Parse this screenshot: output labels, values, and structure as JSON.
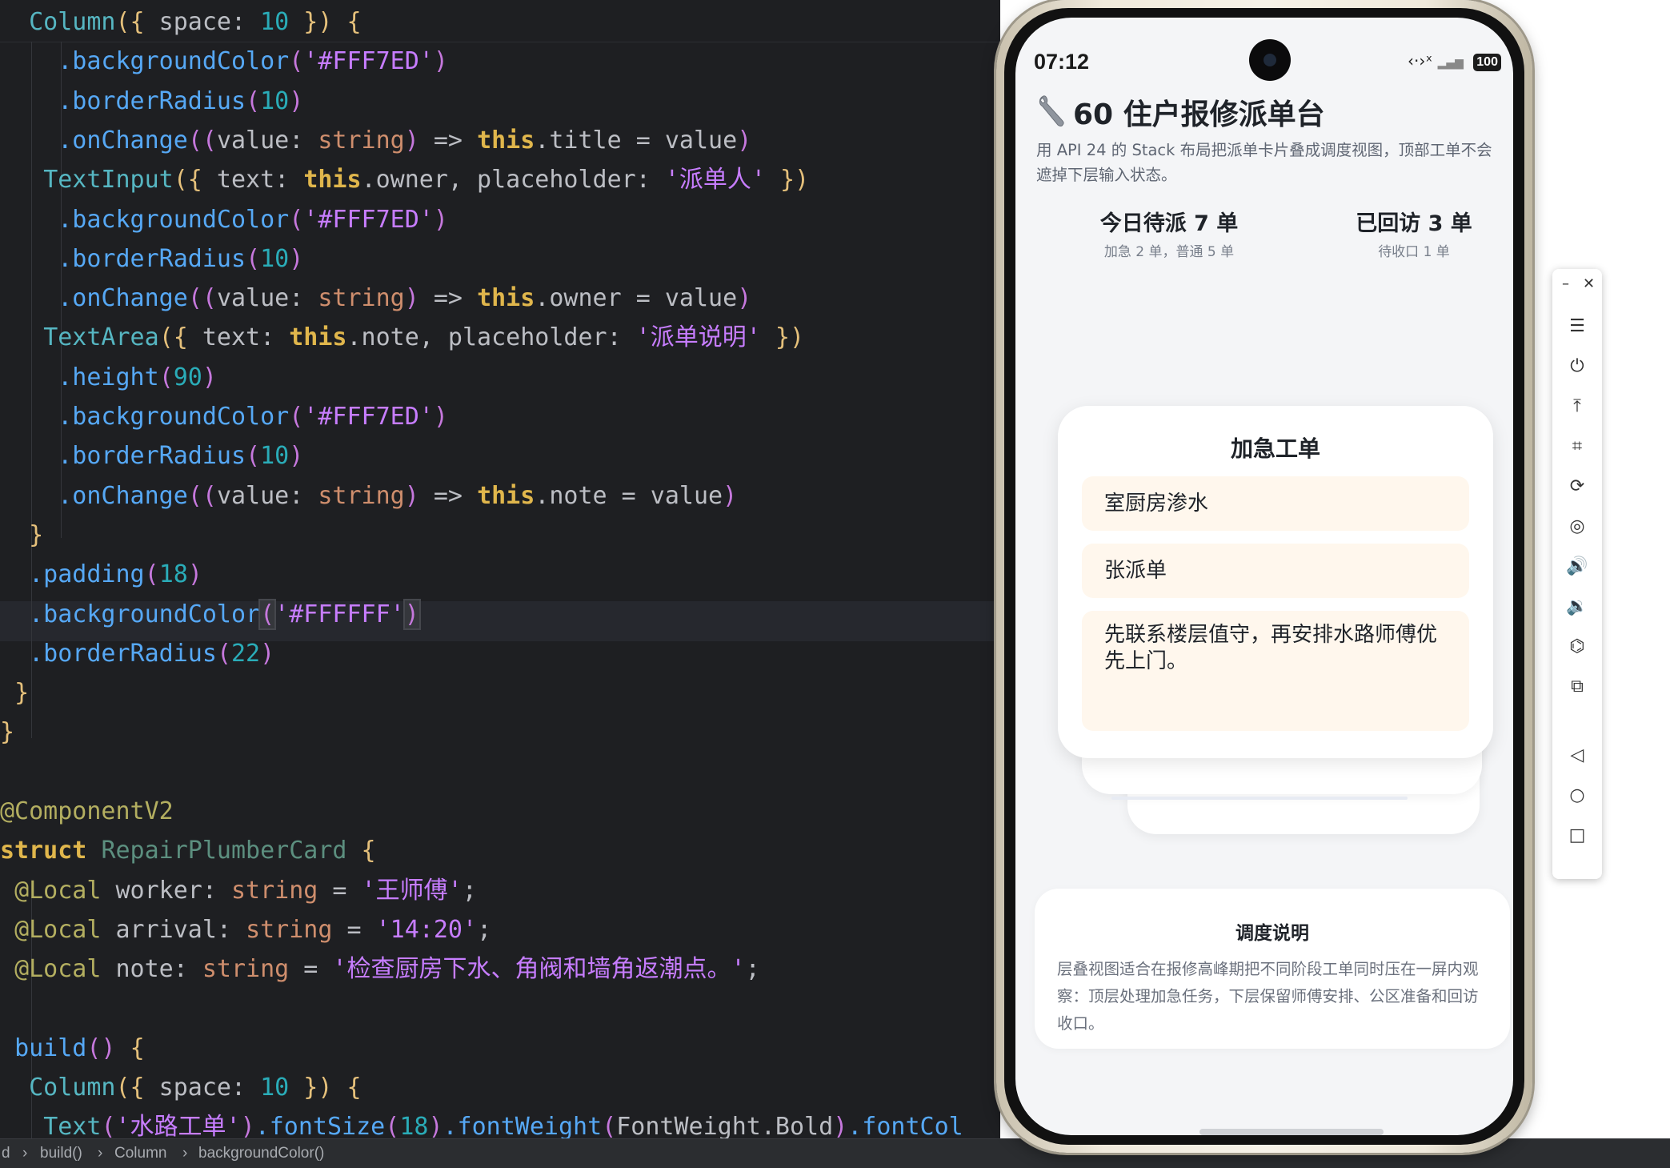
{
  "editor": {
    "lines": [
      [
        [
          "k-pl",
          "  "
        ],
        [
          "k-cm",
          "Column"
        ],
        [
          "k-br",
          "({"
        ],
        [
          "k-pl",
          " space: "
        ],
        [
          "k-num",
          "10"
        ],
        [
          "k-br",
          " })"
        ],
        [
          "k-pl",
          " "
        ],
        [
          "k-br",
          "{"
        ]
      ],
      [
        [
          "k-pl",
          "    "
        ],
        [
          "k-fn",
          ".backgroundColor"
        ],
        [
          "k-bp",
          "("
        ],
        [
          "k-st",
          "'#FFF7ED'"
        ],
        [
          "k-bp",
          ")"
        ]
      ],
      [
        [
          "k-pl",
          "    "
        ],
        [
          "k-fn",
          ".borderRadius"
        ],
        [
          "k-bp",
          "("
        ],
        [
          "k-num",
          "10"
        ],
        [
          "k-bp",
          ")"
        ]
      ],
      [
        [
          "k-pl",
          "    "
        ],
        [
          "k-fn",
          ".onChange"
        ],
        [
          "k-bp",
          "(("
        ],
        [
          "k-pl",
          "value: "
        ],
        [
          "k-ty",
          "string"
        ],
        [
          "k-bp",
          ")"
        ],
        [
          "k-pl",
          " => "
        ],
        [
          "k-kw",
          "this"
        ],
        [
          "k-pl",
          ".title = value"
        ],
        [
          "k-bp",
          ")"
        ]
      ],
      [
        [
          "k-pl",
          "   "
        ],
        [
          "k-cm",
          "TextInput"
        ],
        [
          "k-br",
          "({"
        ],
        [
          "k-pl",
          " text: "
        ],
        [
          "k-kw",
          "this"
        ],
        [
          "k-pl",
          ".owner, placeholder: "
        ],
        [
          "k-st",
          "'派单人'"
        ],
        [
          "k-br",
          " })"
        ]
      ],
      [
        [
          "k-pl",
          "    "
        ],
        [
          "k-fn",
          ".backgroundColor"
        ],
        [
          "k-bp",
          "("
        ],
        [
          "k-st",
          "'#FFF7ED'"
        ],
        [
          "k-bp",
          ")"
        ]
      ],
      [
        [
          "k-pl",
          "    "
        ],
        [
          "k-fn",
          ".borderRadius"
        ],
        [
          "k-bp",
          "("
        ],
        [
          "k-num",
          "10"
        ],
        [
          "k-bp",
          ")"
        ]
      ],
      [
        [
          "k-pl",
          "    "
        ],
        [
          "k-fn",
          ".onChange"
        ],
        [
          "k-bp",
          "(("
        ],
        [
          "k-pl",
          "value: "
        ],
        [
          "k-ty",
          "string"
        ],
        [
          "k-bp",
          ")"
        ],
        [
          "k-pl",
          " => "
        ],
        [
          "k-kw",
          "this"
        ],
        [
          "k-pl",
          ".owner = value"
        ],
        [
          "k-bp",
          ")"
        ]
      ],
      [
        [
          "k-pl",
          "   "
        ],
        [
          "k-cm",
          "TextArea"
        ],
        [
          "k-br",
          "({"
        ],
        [
          "k-pl",
          " text: "
        ],
        [
          "k-kw",
          "this"
        ],
        [
          "k-pl",
          ".note, placeholder: "
        ],
        [
          "k-st",
          "'派单说明'"
        ],
        [
          "k-br",
          " })"
        ]
      ],
      [
        [
          "k-pl",
          "    "
        ],
        [
          "k-fn",
          ".height"
        ],
        [
          "k-bp",
          "("
        ],
        [
          "k-num",
          "90"
        ],
        [
          "k-bp",
          ")"
        ]
      ],
      [
        [
          "k-pl",
          "    "
        ],
        [
          "k-fn",
          ".backgroundColor"
        ],
        [
          "k-bp",
          "("
        ],
        [
          "k-st",
          "'#FFF7ED'"
        ],
        [
          "k-bp",
          ")"
        ]
      ],
      [
        [
          "k-pl",
          "    "
        ],
        [
          "k-fn",
          ".borderRadius"
        ],
        [
          "k-bp",
          "("
        ],
        [
          "k-num",
          "10"
        ],
        [
          "k-bp",
          ")"
        ]
      ],
      [
        [
          "k-pl",
          "    "
        ],
        [
          "k-fn",
          ".onChange"
        ],
        [
          "k-bp",
          "(("
        ],
        [
          "k-pl",
          "value: "
        ],
        [
          "k-ty",
          "string"
        ],
        [
          "k-bp",
          ")"
        ],
        [
          "k-pl",
          " => "
        ],
        [
          "k-kw",
          "this"
        ],
        [
          "k-pl",
          ".note = value"
        ],
        [
          "k-bp",
          ")"
        ]
      ],
      [
        [
          "k-pl",
          "  "
        ],
        [
          "k-br",
          "}"
        ]
      ],
      [
        [
          "k-pl",
          "  "
        ],
        [
          "k-fn",
          ".padding"
        ],
        [
          "k-bp",
          "("
        ],
        [
          "k-num",
          "18"
        ],
        [
          "k-bp",
          ")"
        ]
      ],
      [
        [
          "k-pl",
          "  "
        ],
        [
          "k-fn",
          ".backgroundColor"
        ],
        [
          "k-bp caret-box",
          "("
        ],
        [
          "k-st",
          "'#FFFFFF'"
        ],
        [
          "k-bp caret-box",
          ")"
        ]
      ],
      [
        [
          "k-pl",
          "  "
        ],
        [
          "k-fn",
          ".borderRadius"
        ],
        [
          "k-bp",
          "("
        ],
        [
          "k-num",
          "22"
        ],
        [
          "k-bp",
          ")"
        ]
      ],
      [
        [
          "k-pl",
          " "
        ],
        [
          "k-br",
          "}"
        ]
      ],
      [
        [
          "k-br",
          "}"
        ]
      ],
      [
        [
          "k-pl",
          ""
        ]
      ],
      [
        [
          "k-an",
          "@ComponentV2"
        ]
      ],
      [
        [
          "k-kw",
          "struct"
        ],
        [
          "k-pl",
          " "
        ],
        [
          "k-sn",
          "RepairPlumberCard"
        ],
        [
          "k-pl",
          " "
        ],
        [
          "k-br",
          "{"
        ]
      ],
      [
        [
          "k-pl",
          " "
        ],
        [
          "k-an",
          "@Local"
        ],
        [
          "k-pl",
          " worker: "
        ],
        [
          "k-ty",
          "string"
        ],
        [
          "k-pl",
          " = "
        ],
        [
          "k-st",
          "'王师傅'"
        ],
        [
          "k-pl",
          ";"
        ]
      ],
      [
        [
          "k-pl",
          " "
        ],
        [
          "k-an",
          "@Local"
        ],
        [
          "k-pl",
          " arrival: "
        ],
        [
          "k-ty",
          "string"
        ],
        [
          "k-pl",
          " = "
        ],
        [
          "k-st",
          "'14:20'"
        ],
        [
          "k-pl",
          ";"
        ]
      ],
      [
        [
          "k-pl",
          " "
        ],
        [
          "k-an",
          "@Local"
        ],
        [
          "k-pl",
          " note: "
        ],
        [
          "k-ty",
          "string"
        ],
        [
          "k-pl",
          " = "
        ],
        [
          "k-st",
          "'检查厨房下水、角阀和墙角返潮点。'"
        ],
        [
          "k-pl",
          ";"
        ]
      ],
      [
        [
          "k-pl",
          ""
        ]
      ],
      [
        [
          "k-pl",
          " "
        ],
        [
          "k-fn",
          "build"
        ],
        [
          "k-bp",
          "()"
        ],
        [
          "k-pl",
          " "
        ],
        [
          "k-br",
          "{"
        ]
      ],
      [
        [
          "k-pl",
          "  "
        ],
        [
          "k-cm",
          "Column"
        ],
        [
          "k-br",
          "({"
        ],
        [
          "k-pl",
          " space: "
        ],
        [
          "k-num",
          "10"
        ],
        [
          "k-br",
          " })"
        ],
        [
          "k-pl",
          " "
        ],
        [
          "k-br",
          "{"
        ]
      ],
      [
        [
          "k-pl",
          "   "
        ],
        [
          "k-cm",
          "Text"
        ],
        [
          "k-bp",
          "("
        ],
        [
          "k-st",
          "'水路工单'"
        ],
        [
          "k-bp",
          ")"
        ],
        [
          "k-fn",
          ".fontSize"
        ],
        [
          "k-bp",
          "("
        ],
        [
          "k-num",
          "18"
        ],
        [
          "k-bp",
          ")"
        ],
        [
          "k-fn",
          ".fontWeight"
        ],
        [
          "k-bp",
          "("
        ],
        [
          "k-pl",
          "FontWeight.Bold"
        ],
        [
          "k-bp",
          ")"
        ],
        [
          "k-fn",
          ".fontCol"
        ]
      ]
    ]
  },
  "statusbar": {
    "crumbs": [
      "d",
      "build()",
      "Column",
      "backgroundColor()"
    ],
    "separator": "›"
  },
  "phone": {
    "time": "07:12",
    "signal_text": "‹·›ˣ",
    "signal_bars": "▂▄▆",
    "battery": "100",
    "app": {
      "title": "60 住户报修派单台",
      "subtitle": "用 API 24 的 Stack 布局把派单卡片叠成调度视图，顶部工单不会遮掉下层输入状态。",
      "stats": [
        {
          "value": "今日待派 7 单",
          "detail": "加急 2 单，普通 5 单"
        },
        {
          "value": "已回访 3 单",
          "detail": "待收口 1 单"
        }
      ],
      "card": {
        "title": "加急工单",
        "title_field": "室厨房渗水",
        "owner_field": "张派单",
        "note_field": "先联系楼层值守，再安排水路师傅优先上门。"
      },
      "note": {
        "title": "调度说明",
        "body": "层叠视图适合在报修高峰期把不同阶段工单同时压在一屏内观察：顶层处理加急任务，下层保留师傅安排、公区准备和回访收口。"
      }
    }
  },
  "toolbar": {
    "minimize": "–",
    "close": "✕",
    "buttons": [
      {
        "name": "menu-icon",
        "glyph": "☰"
      },
      {
        "name": "power-icon",
        "glyph": "⏻"
      },
      {
        "name": "pin-top-icon",
        "glyph": "⤒"
      },
      {
        "name": "crop-icon",
        "glyph": "⌗"
      },
      {
        "name": "rotate-icon",
        "glyph": "⟳"
      },
      {
        "name": "location-icon",
        "glyph": "◎"
      },
      {
        "name": "volume-up-icon",
        "glyph": "🔊"
      },
      {
        "name": "volume-down-icon",
        "glyph": "🔉"
      },
      {
        "name": "shake-icon",
        "glyph": "⌬"
      },
      {
        "name": "multi-device-icon",
        "glyph": "⧉"
      },
      {
        "name": "back-icon",
        "glyph": "◁"
      },
      {
        "name": "home-icon",
        "glyph": "○"
      },
      {
        "name": "recent-apps-icon",
        "glyph": "□"
      }
    ]
  }
}
